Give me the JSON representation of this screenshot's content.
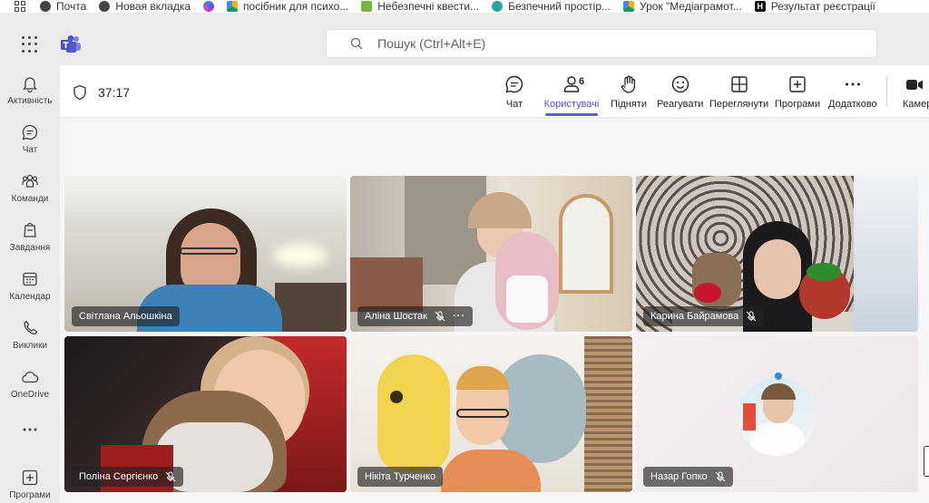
{
  "bookmarks": [
    {
      "label": "Почта",
      "color": "#444444"
    },
    {
      "label": "Новая вкладка",
      "color": "#444444"
    },
    {
      "label": "",
      "color": "#6b5bd8"
    },
    {
      "label": "посібник для психо...",
      "color": "#f4b400"
    },
    {
      "label": "Небезпечні квести...",
      "color": "#7cb342"
    },
    {
      "label": "Безпечний простір...",
      "color": "#26a69a"
    },
    {
      "label": "Урок \"Медіаграмот...",
      "color": "#f4b400"
    },
    {
      "label": "Результат реєстрації",
      "color": "#111111"
    }
  ],
  "search": {
    "placeholder": "Пошук (Ctrl+Alt+E)"
  },
  "rail": [
    {
      "label": "Активність",
      "icon": "bell-icon"
    },
    {
      "label": "Чат",
      "icon": "chat-icon"
    },
    {
      "label": "Команди",
      "icon": "teams-icon"
    },
    {
      "label": "Завдання",
      "icon": "assignments-icon"
    },
    {
      "label": "Календар",
      "icon": "calendar-icon"
    },
    {
      "label": "Виклики",
      "icon": "phone-icon"
    },
    {
      "label": "OneDrive",
      "icon": "cloud-icon"
    },
    {
      "label": "",
      "icon": "more-icon"
    },
    {
      "label": "Програми",
      "icon": "plus-icon"
    }
  ],
  "meeting": {
    "timer": "37:17",
    "people_count": "6",
    "toolbar": {
      "chat": "Чат",
      "people": "Користувачі",
      "raise": "Підняти",
      "react": "Реагувати",
      "view": "Переглянути",
      "apps": "Програми",
      "more": "Додатково",
      "camera": "Камер"
    }
  },
  "participants": [
    {
      "name": "Світлана Альошкіна",
      "muted": false
    },
    {
      "name": "Аліна Шостак",
      "muted": true
    },
    {
      "name": "Карина Байрамова",
      "muted": true
    },
    {
      "name": "Поліна Сергієнко",
      "muted": true
    },
    {
      "name": "Нікіта Турченко",
      "muted": false
    },
    {
      "name": "Назар Гопко",
      "muted": true
    }
  ],
  "colors": {
    "accent": "#5b5fc7"
  }
}
